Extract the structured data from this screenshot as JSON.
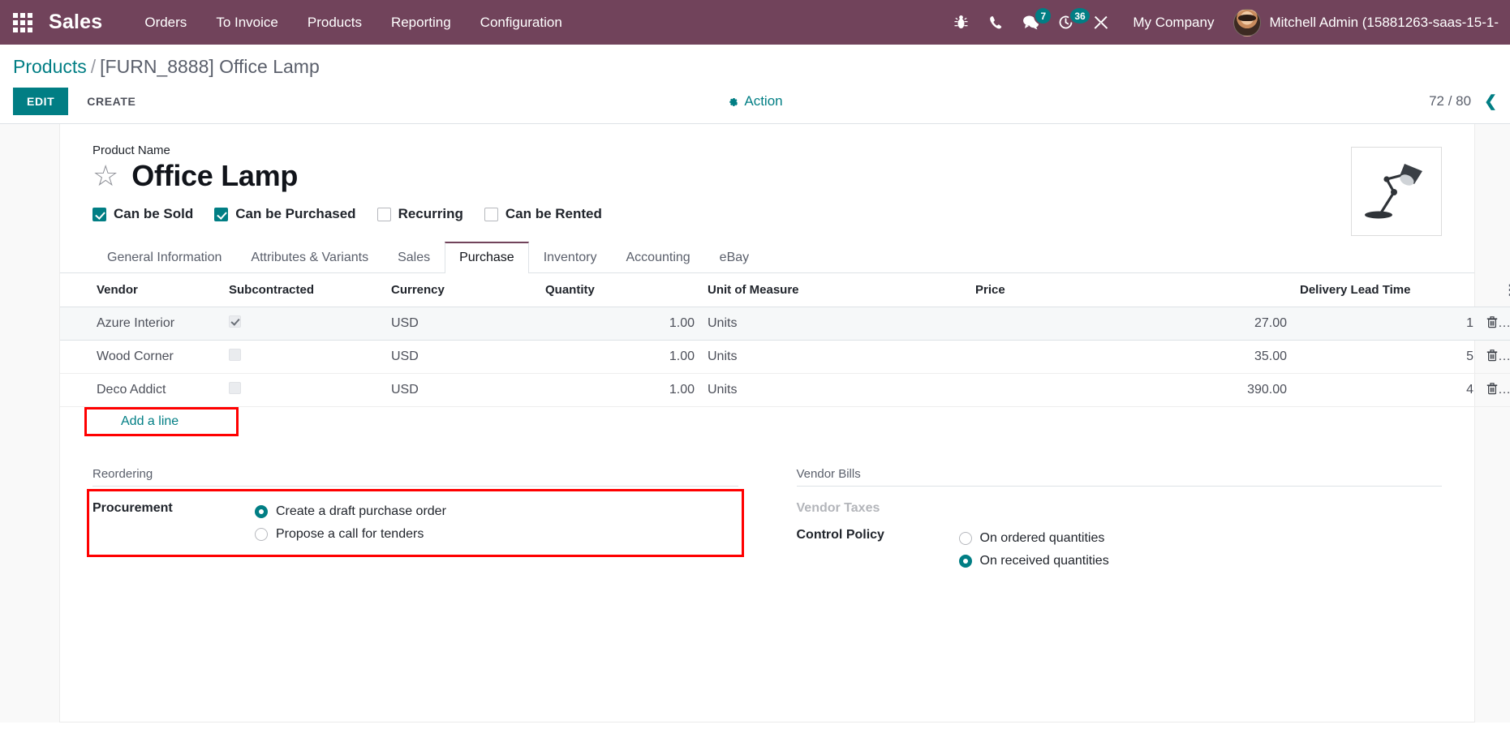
{
  "navbar": {
    "apps_icon": "apps-grid-icon",
    "brand": "Sales",
    "menu": [
      {
        "label": "Orders"
      },
      {
        "label": "To Invoice"
      },
      {
        "label": "Products"
      },
      {
        "label": "Reporting"
      },
      {
        "label": "Configuration"
      }
    ],
    "icons": [
      {
        "name": "bug-icon",
        "badge": ""
      },
      {
        "name": "phone-icon",
        "badge": ""
      },
      {
        "name": "messages-icon",
        "badge": "7"
      },
      {
        "name": "activities-clock-icon",
        "badge": "36"
      },
      {
        "name": "tools-icon",
        "badge": ""
      }
    ],
    "company": "My Company",
    "user": "Mitchell Admin (15881263-saas-15-1-",
    "accent": "#71435b",
    "badge_color": "#017e84"
  },
  "control_panel": {
    "breadcrumb_root": "Products",
    "breadcrumb_separator": "/",
    "breadcrumb_current": "[FURN_8888] Office Lamp",
    "edit_label": "EDIT",
    "create_label": "CREATE",
    "action_label": "Action",
    "action_icon": "gear-icon",
    "pager": "72 / 80",
    "pager_prev_icon": "chevron-left-icon"
  },
  "form": {
    "product_name_label": "Product Name",
    "product_name": "Office Lamp",
    "favorite_icon": "star-outline-icon",
    "product_image_icon": "desk-lamp-image",
    "checkboxes": [
      {
        "label": "Can be Sold",
        "checked": true
      },
      {
        "label": "Can be Purchased",
        "checked": true
      },
      {
        "label": "Recurring",
        "checked": false
      },
      {
        "label": "Can be Rented",
        "checked": false
      }
    ]
  },
  "tabs": [
    {
      "label": "General Information",
      "active": false
    },
    {
      "label": "Attributes & Variants",
      "active": false
    },
    {
      "label": "Sales",
      "active": false
    },
    {
      "label": "Purchase",
      "active": true
    },
    {
      "label": "Inventory",
      "active": false
    },
    {
      "label": "Accounting",
      "active": false
    },
    {
      "label": "eBay",
      "active": false
    }
  ],
  "vendor_table": {
    "columns": [
      "Vendor",
      "Subcontracted",
      "Currency",
      "Quantity",
      "Unit of Measure",
      "Price",
      "Delivery Lead Time"
    ],
    "optional_columns_icon": "vertical-dots-icon",
    "rows": [
      {
        "vendor": "Azure Interior",
        "subcontracted": true,
        "currency": "USD",
        "quantity": "1.00",
        "uom": "Units",
        "price": "27.00",
        "lead_time": "1",
        "delete_icon": "trash-icon",
        "selected": true
      },
      {
        "vendor": "Wood Corner",
        "subcontracted": false,
        "currency": "USD",
        "quantity": "1.00",
        "uom": "Units",
        "price": "35.00",
        "lead_time": "5",
        "delete_icon": "trash-icon",
        "selected": false
      },
      {
        "vendor": "Deco Addict",
        "subcontracted": false,
        "currency": "USD",
        "quantity": "1.00",
        "uom": "Units",
        "price": "390.00",
        "lead_time": "4",
        "delete_icon": "trash-icon",
        "selected": false
      }
    ],
    "add_line_label": "Add a line"
  },
  "reordering": {
    "group_title": "Reordering",
    "procurement_label": "Procurement",
    "options": [
      {
        "label": "Create a draft purchase order",
        "selected": true
      },
      {
        "label": "Propose a call for tenders",
        "selected": false
      }
    ]
  },
  "vendor_bills": {
    "group_title": "Vendor Bills",
    "vendor_taxes_label": "Vendor Taxes",
    "control_policy_label": "Control Policy",
    "options": [
      {
        "label": "On ordered quantities",
        "selected": false
      },
      {
        "label": "On received quantities",
        "selected": true
      }
    ]
  },
  "highlight_color": "#ff0000"
}
